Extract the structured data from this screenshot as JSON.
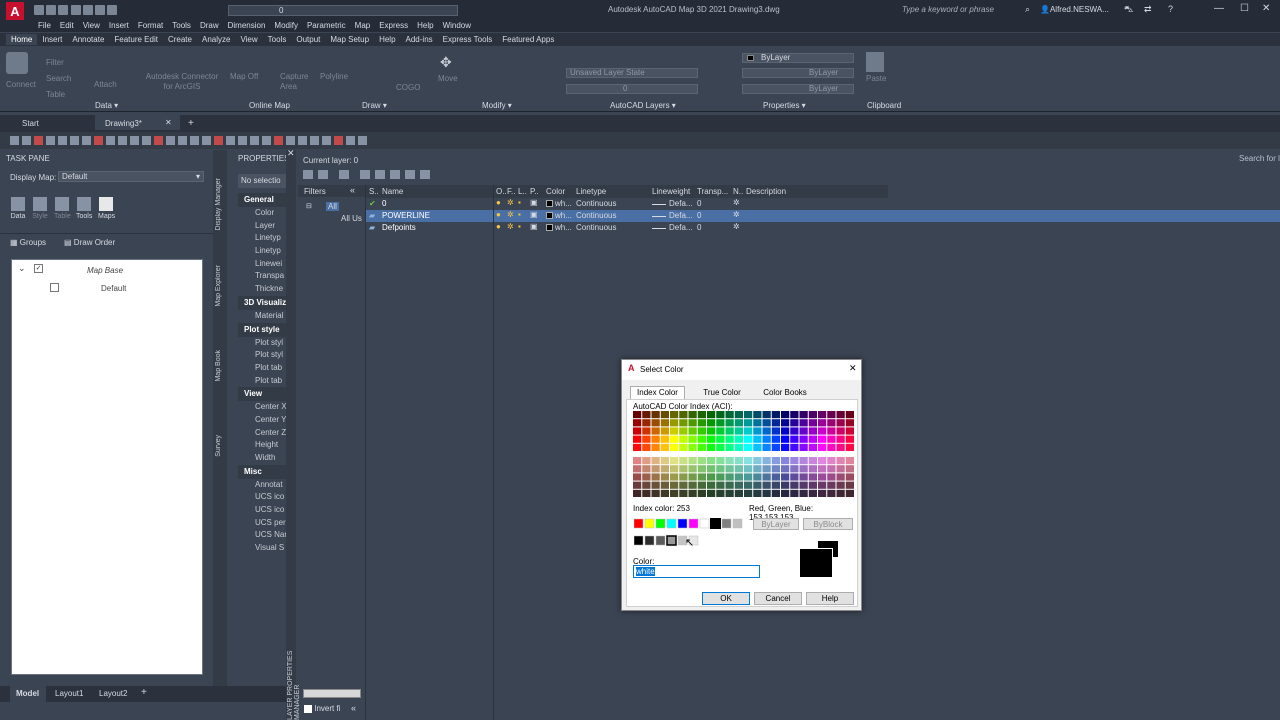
{
  "app": {
    "title": "Autodesk AutoCAD Map 3D 2021    Drawing3.dwg",
    "search_placeholder": "Type a keyword or phrase",
    "user": "Alfred.NESWA..."
  },
  "qat": {
    "layer_value": "0"
  },
  "menus": [
    "File",
    "Edit",
    "View",
    "Insert",
    "Format",
    "Tools",
    "Draw",
    "Dimension",
    "Modify",
    "Parametric",
    "Map",
    "Express",
    "Help",
    "Window"
  ],
  "ribbon_tabs": [
    "Home",
    "Insert",
    "Annotate",
    "Feature Edit",
    "Create",
    "Analyze",
    "View",
    "Tools",
    "Output",
    "Map Setup",
    "Help",
    "Add-ins",
    "Express Tools",
    "Featured Apps"
  ],
  "ribbon_groups": [
    {
      "label": "Data ▾",
      "items": [
        "Connect",
        "Filter",
        "Search",
        "Table",
        "Attach"
      ]
    },
    {
      "label": "Online Map",
      "items": [
        "Autodesk Connector for ArcGIS",
        "Map Off",
        "Capture Area"
      ]
    },
    {
      "label": "Draw ▾",
      "items": [
        "Polyline",
        "COGO"
      ]
    },
    {
      "label": "Modify ▾",
      "items": [
        "Move"
      ]
    },
    {
      "label": "AutoCAD Layers ▾",
      "items": [
        "Unsaved Layer State",
        "0"
      ]
    },
    {
      "label": "Properties ▾",
      "items": [
        "ByLayer",
        "ByLayer",
        "ByLayer"
      ]
    },
    {
      "label": "Clipboard",
      "items": [
        "Paste"
      ]
    }
  ],
  "doc_tabs": [
    "Start",
    "Drawing3*",
    "+"
  ],
  "task_pane": {
    "title": "TASK PANE",
    "display_map_label": "Display Map:",
    "display_map_value": "Default",
    "tools": [
      "Data",
      "Style",
      "Table",
      "Tools",
      "Maps"
    ],
    "groups_btn": "Groups",
    "draw_order_btn": "Draw Order",
    "tree": [
      "Map Base",
      "Default"
    ],
    "side_tabs": [
      "Display Manager",
      "Map Explorer",
      "Map Book",
      "Survey"
    ]
  },
  "properties": {
    "title": "PROPERTIES",
    "selection": "No selectio",
    "sections": [
      {
        "name": "General",
        "items": [
          "Color",
          "Layer",
          "Linetyp",
          "Linetyp",
          "Linewei",
          "Transpa",
          "Thickne"
        ]
      },
      {
        "name": "3D Visualiz",
        "items": [
          "Material"
        ]
      },
      {
        "name": "Plot style",
        "items": [
          "Plot styl",
          "Plot styl",
          "Plot tab",
          "Plot tab"
        ]
      },
      {
        "name": "View",
        "items": [
          "Center X",
          "Center Y",
          "Center Z",
          "Height",
          "Width"
        ]
      },
      {
        "name": "Misc",
        "items": [
          "Annotat",
          "UCS ico",
          "UCS ico",
          "UCS per",
          "UCS Nar",
          "Visual S"
        ]
      }
    ]
  },
  "layer_manager": {
    "current_layer": "Current layer: 0",
    "search_label": "Search for l",
    "side_label": "LAYER PROPERTIES MANAGER",
    "filters_label": "Filters",
    "filter_tree": [
      "All",
      "All Us"
    ],
    "invert_label": "Invert fi",
    "columns": [
      "S..",
      "Name",
      "O..",
      "F..",
      "L..",
      "P..",
      "Color",
      "Linetype",
      "Lineweight",
      "Transp...",
      "N..",
      "Description"
    ],
    "rows": [
      {
        "name": "0",
        "color": "wh...",
        "linetype": "Continuous",
        "lineweight": "Defa...",
        "transp": "0"
      },
      {
        "name": "POWERLINE",
        "color": "wh...",
        "linetype": "Continuous",
        "lineweight": "Defa...",
        "transp": "0"
      },
      {
        "name": "Defpoints",
        "color": "wh...",
        "linetype": "Continuous",
        "lineweight": "Defa...",
        "transp": "0"
      }
    ]
  },
  "dialog": {
    "title": "Select Color",
    "tabs": [
      "Index Color",
      "True Color",
      "Color Books"
    ],
    "aci_label": "AutoCAD Color Index (ACI):",
    "index_label": "Index color:  253",
    "rgb_label": "Red, Green, Blue:    153,153,153",
    "bylayer": "ByLayer",
    "byblock": "ByBlock",
    "color_label": "Color:",
    "color_value": "white",
    "ok": "OK",
    "cancel": "Cancel",
    "help": "Help"
  },
  "layouts": [
    "Model",
    "Layout1",
    "Layout2",
    "+"
  ]
}
